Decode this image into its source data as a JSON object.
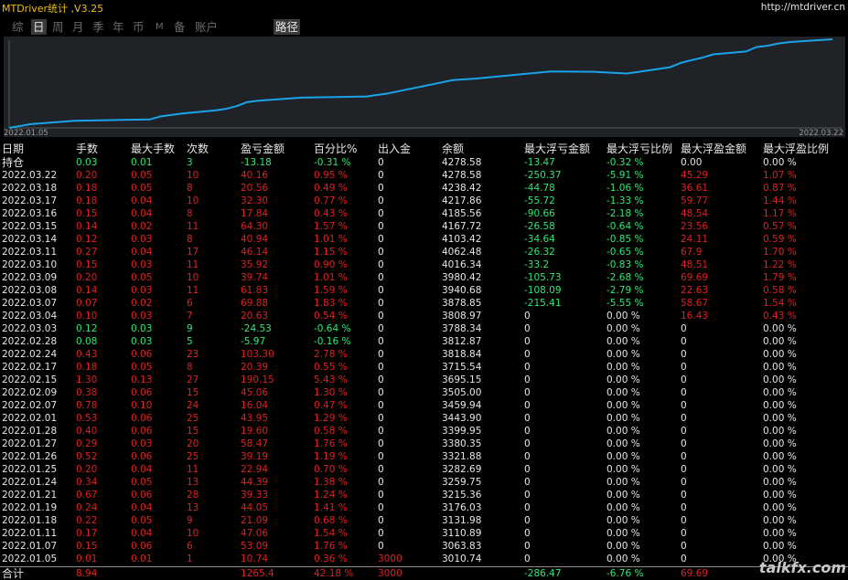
{
  "header": {
    "title": "MTDriver统计 ,V3.25",
    "link": "http://mtdriver.cn"
  },
  "tabs": [
    "综",
    "日",
    "周",
    "月",
    "季",
    "年",
    "币",
    "M",
    "备",
    "账户",
    "路径"
  ],
  "active_tabs": [
    "日",
    "路径"
  ],
  "chart_data": {
    "type": "line",
    "x_start_label": "2022.01.05",
    "x_end_label": "2022.03.22",
    "dates": [
      "2022.01.05",
      "2022.01.07",
      "2022.01.11",
      "2022.01.18",
      "2022.01.19",
      "2022.01.21",
      "2022.01.24",
      "2022.01.25",
      "2022.01.26",
      "2022.01.27",
      "2022.01.28",
      "2022.02.01",
      "2022.02.07",
      "2022.02.09",
      "2022.02.15",
      "2022.02.17",
      "2022.02.24",
      "2022.02.28",
      "2022.03.03",
      "2022.03.04",
      "2022.03.07",
      "2022.03.08",
      "2022.03.09",
      "2022.03.10",
      "2022.03.11",
      "2022.03.14",
      "2022.03.15",
      "2022.03.16",
      "2022.03.17",
      "2022.03.18",
      "2022.03.22"
    ],
    "values": [
      3010.74,
      3063.83,
      3110.89,
      3131.98,
      3176.03,
      3215.36,
      3259.75,
      3282.69,
      3321.88,
      3380.35,
      3399.95,
      3443.9,
      3459.94,
      3505.0,
      3695.15,
      3715.54,
      3818.84,
      3812.87,
      3788.34,
      3808.97,
      3878.85,
      3940.68,
      3980.42,
      4016.34,
      4062.48,
      4103.42,
      4167.72,
      4185.56,
      4217.86,
      4238.42,
      4278.58
    ],
    "colors": {
      "line": "#1aa3e8",
      "background": "#1f2227"
    }
  },
  "table": {
    "headers": [
      "日期",
      "手数",
      "最大手数",
      "次数",
      "盈亏金额",
      "百分比%",
      "出入金",
      "余额",
      "最大浮亏金额",
      "最大浮亏比例",
      "最大浮盈金额",
      "最大浮盈比例"
    ],
    "holding": {
      "label": "持仓",
      "cells": [
        "0.03",
        "0.01",
        "3",
        "-13.18",
        "-0.31 %",
        "0",
        "4278.58",
        "-13.47",
        "-0.32 %",
        "0.00",
        "0.00 %"
      ]
    },
    "rows": [
      {
        "date": "2022.03.22",
        "lots": "0.20",
        "maxlots": "0.05",
        "count": "10",
        "pnl": "40.16",
        "pct": "0.95 %",
        "cash": "0",
        "bal": "4278.58",
        "mfl": "-250.37",
        "mflp": "-5.91 %",
        "mfp": "45.29",
        "mfpp": "1.07 %"
      },
      {
        "date": "2022.03.18",
        "lots": "0.18",
        "maxlots": "0.05",
        "count": "8",
        "pnl": "20.56",
        "pct": "0.49 %",
        "cash": "0",
        "bal": "4238.42",
        "mfl": "-44.78",
        "mflp": "-1.06 %",
        "mfp": "36.61",
        "mfpp": "0.87 %"
      },
      {
        "date": "2022.03.17",
        "lots": "0.18",
        "maxlots": "0.04",
        "count": "10",
        "pnl": "32.30",
        "pct": "0.77 %",
        "cash": "0",
        "bal": "4217.86",
        "mfl": "-55.72",
        "mflp": "-1.33 %",
        "mfp": "59.77",
        "mfpp": "1.44 %"
      },
      {
        "date": "2022.03.16",
        "lots": "0.15",
        "maxlots": "0.04",
        "count": "8",
        "pnl": "17.84",
        "pct": "0.43 %",
        "cash": "0",
        "bal": "4185.56",
        "mfl": "-90.66",
        "mflp": "-2.18 %",
        "mfp": "48.54",
        "mfpp": "1.17 %"
      },
      {
        "date": "2022.03.15",
        "lots": "0.14",
        "maxlots": "0.02",
        "count": "11",
        "pnl": "64.30",
        "pct": "1.57 %",
        "cash": "0",
        "bal": "4167.72",
        "mfl": "-26.58",
        "mflp": "-0.64 %",
        "mfp": "23.56",
        "mfpp": "0.57 %"
      },
      {
        "date": "2022.03.14",
        "lots": "0.12",
        "maxlots": "0.03",
        "count": "8",
        "pnl": "40.94",
        "pct": "1.01 %",
        "cash": "0",
        "bal": "4103.42",
        "mfl": "-34.64",
        "mflp": "-0.85 %",
        "mfp": "24.11",
        "mfpp": "0.59 %"
      },
      {
        "date": "2022.03.11",
        "lots": "0.27",
        "maxlots": "0.04",
        "count": "17",
        "pnl": "46.14",
        "pct": "1.15 %",
        "cash": "0",
        "bal": "4062.48",
        "mfl": "-26.32",
        "mflp": "-0.65 %",
        "mfp": "67.9",
        "mfpp": "1.70 %"
      },
      {
        "date": "2022.03.10",
        "lots": "0.15",
        "maxlots": "0.03",
        "count": "11",
        "pnl": "35.92",
        "pct": "0.90 %",
        "cash": "0",
        "bal": "4016.34",
        "mfl": "-33.2",
        "mflp": "-0.83 %",
        "mfp": "48.51",
        "mfpp": "1.22 %"
      },
      {
        "date": "2022.03.09",
        "lots": "0.20",
        "maxlots": "0.05",
        "count": "10",
        "pnl": "39.74",
        "pct": "1.01 %",
        "cash": "0",
        "bal": "3980.42",
        "mfl": "-105.73",
        "mflp": "-2.68 %",
        "mfp": "69.69",
        "mfpp": "1.79 %"
      },
      {
        "date": "2022.03.08",
        "lots": "0.14",
        "maxlots": "0.03",
        "count": "11",
        "pnl": "61.83",
        "pct": "1.59 %",
        "cash": "0",
        "bal": "3940.68",
        "mfl": "-108.09",
        "mflp": "-2.79 %",
        "mfp": "22.63",
        "mfpp": "0.58 %"
      },
      {
        "date": "2022.03.07",
        "lots": "0.07",
        "maxlots": "0.02",
        "count": "6",
        "pnl": "69.88",
        "pct": "1.83 %",
        "cash": "0",
        "bal": "3878.85",
        "mfl": "-215.41",
        "mflp": "-5.55 %",
        "mfp": "58.67",
        "mfpp": "1.54 %"
      },
      {
        "date": "2022.03.04",
        "lots": "0.10",
        "maxlots": "0.03",
        "count": "7",
        "pnl": "20.63",
        "pct": "0.54 %",
        "cash": "0",
        "bal": "3808.97",
        "mfl": "0",
        "mflp": "0.00 %",
        "mfp": "16.43",
        "mfpp": "0.43 %"
      },
      {
        "date": "2022.03.03",
        "lots": "0.12",
        "maxlots": "0.03",
        "count": "9",
        "pnl": "-24.53",
        "pct": "-0.64 %",
        "cash": "0",
        "bal": "3788.34",
        "mfl": "0",
        "mflp": "0.00 %",
        "mfp": "0",
        "mfpp": "0.00 %"
      },
      {
        "date": "2022.02.28",
        "lots": "0.08",
        "maxlots": "0.03",
        "count": "5",
        "pnl": "-5.97",
        "pct": "-0.16 %",
        "cash": "0",
        "bal": "3812.87",
        "mfl": "0",
        "mflp": "0.00 %",
        "mfp": "0",
        "mfpp": "0.00 %"
      },
      {
        "date": "2022.02.24",
        "lots": "0.43",
        "maxlots": "0.06",
        "count": "23",
        "pnl": "103.30",
        "pct": "2.78 %",
        "cash": "0",
        "bal": "3818.84",
        "mfl": "0",
        "mflp": "0.00 %",
        "mfp": "0",
        "mfpp": "0.00 %"
      },
      {
        "date": "2022.02.17",
        "lots": "0.18",
        "maxlots": "0.05",
        "count": "8",
        "pnl": "20.39",
        "pct": "0.55 %",
        "cash": "0",
        "bal": "3715.54",
        "mfl": "0",
        "mflp": "0.00 %",
        "mfp": "0",
        "mfpp": "0.00 %"
      },
      {
        "date": "2022.02.15",
        "lots": "1.30",
        "maxlots": "0.13",
        "count": "27",
        "pnl": "190.15",
        "pct": "5.43 %",
        "cash": "0",
        "bal": "3695.15",
        "mfl": "0",
        "mflp": "0.00 %",
        "mfp": "0",
        "mfpp": "0.00 %"
      },
      {
        "date": "2022.02.09",
        "lots": "0.38",
        "maxlots": "0.06",
        "count": "15",
        "pnl": "45.06",
        "pct": "1.30 %",
        "cash": "0",
        "bal": "3505.00",
        "mfl": "0",
        "mflp": "0.00 %",
        "mfp": "0",
        "mfpp": "0.00 %"
      },
      {
        "date": "2022.02.07",
        "lots": "0.78",
        "maxlots": "0.10",
        "count": "24",
        "pnl": "16.04",
        "pct": "0.47 %",
        "cash": "0",
        "bal": "3459.94",
        "mfl": "0",
        "mflp": "0.00 %",
        "mfp": "0",
        "mfpp": "0.00 %"
      },
      {
        "date": "2022.02.01",
        "lots": "0.53",
        "maxlots": "0.06",
        "count": "25",
        "pnl": "43.95",
        "pct": "1.29 %",
        "cash": "0",
        "bal": "3443.90",
        "mfl": "0",
        "mflp": "0.00 %",
        "mfp": "0",
        "mfpp": "0.00 %"
      },
      {
        "date": "2022.01.28",
        "lots": "0.40",
        "maxlots": "0.06",
        "count": "15",
        "pnl": "19.60",
        "pct": "0.58 %",
        "cash": "0",
        "bal": "3399.95",
        "mfl": "0",
        "mflp": "0.00 %",
        "mfp": "0",
        "mfpp": "0.00 %"
      },
      {
        "date": "2022.01.27",
        "lots": "0.29",
        "maxlots": "0.03",
        "count": "20",
        "pnl": "58.47",
        "pct": "1.76 %",
        "cash": "0",
        "bal": "3380.35",
        "mfl": "0",
        "mflp": "0.00 %",
        "mfp": "0",
        "mfpp": "0.00 %"
      },
      {
        "date": "2022.01.26",
        "lots": "0.52",
        "maxlots": "0.06",
        "count": "25",
        "pnl": "39.19",
        "pct": "1.19 %",
        "cash": "0",
        "bal": "3321.88",
        "mfl": "0",
        "mflp": "0.00 %",
        "mfp": "0",
        "mfpp": "0.00 %"
      },
      {
        "date": "2022.01.25",
        "lots": "0.20",
        "maxlots": "0.04",
        "count": "11",
        "pnl": "22.94",
        "pct": "0.70 %",
        "cash": "0",
        "bal": "3282.69",
        "mfl": "0",
        "mflp": "0.00 %",
        "mfp": "0",
        "mfpp": "0.00 %"
      },
      {
        "date": "2022.01.24",
        "lots": "0.34",
        "maxlots": "0.05",
        "count": "13",
        "pnl": "44.39",
        "pct": "1.38 %",
        "cash": "0",
        "bal": "3259.75",
        "mfl": "0",
        "mflp": "0.00 %",
        "mfp": "0",
        "mfpp": "0.00 %"
      },
      {
        "date": "2022.01.21",
        "lots": "0.67",
        "maxlots": "0.06",
        "count": "28",
        "pnl": "39.33",
        "pct": "1.24 %",
        "cash": "0",
        "bal": "3215.36",
        "mfl": "0",
        "mflp": "0.00 %",
        "mfp": "0",
        "mfpp": "0.00 %"
      },
      {
        "date": "2022.01.19",
        "lots": "0.24",
        "maxlots": "0.04",
        "count": "13",
        "pnl": "44.05",
        "pct": "1.41 %",
        "cash": "0",
        "bal": "3176.03",
        "mfl": "0",
        "mflp": "0.00 %",
        "mfp": "0",
        "mfpp": "0.00 %"
      },
      {
        "date": "2022.01.18",
        "lots": "0.22",
        "maxlots": "0.05",
        "count": "9",
        "pnl": "21.09",
        "pct": "0.68 %",
        "cash": "0",
        "bal": "3131.98",
        "mfl": "0",
        "mflp": "0.00 %",
        "mfp": "0",
        "mfpp": "0.00 %"
      },
      {
        "date": "2022.01.11",
        "lots": "0.17",
        "maxlots": "0.04",
        "count": "10",
        "pnl": "47.06",
        "pct": "1.54 %",
        "cash": "0",
        "bal": "3110.89",
        "mfl": "0",
        "mflp": "0.00 %",
        "mfp": "0",
        "mfpp": "0.00 %"
      },
      {
        "date": "2022.01.07",
        "lots": "0.15",
        "maxlots": "0.06",
        "count": "6",
        "pnl": "53.09",
        "pct": "1.76 %",
        "cash": "0",
        "bal": "3063.83",
        "mfl": "0",
        "mflp": "0.00 %",
        "mfp": "0",
        "mfpp": "0.00 %"
      },
      {
        "date": "2022.01.05",
        "lots": "0.01",
        "maxlots": "0.01",
        "count": "1",
        "pnl": "10.74",
        "pct": "0.36 %",
        "cash": "3000",
        "bal": "3010.74",
        "mfl": "0",
        "mflp": "0.00 %",
        "mfp": "0",
        "mfpp": "0.00 %"
      }
    ],
    "total": {
      "label": "合计",
      "cells": [
        "8.94",
        "",
        "",
        "1265.4",
        "42.18 %",
        "3000",
        "",
        "-286.47",
        "-6.76 %",
        "69.69",
        ""
      ]
    }
  },
  "watermark": "talkfx.com",
  "colors": {
    "profit": "#e02020",
    "loss": "#2ee872",
    "neutral": "#e6e6e6",
    "header": "#e6e6e6"
  }
}
